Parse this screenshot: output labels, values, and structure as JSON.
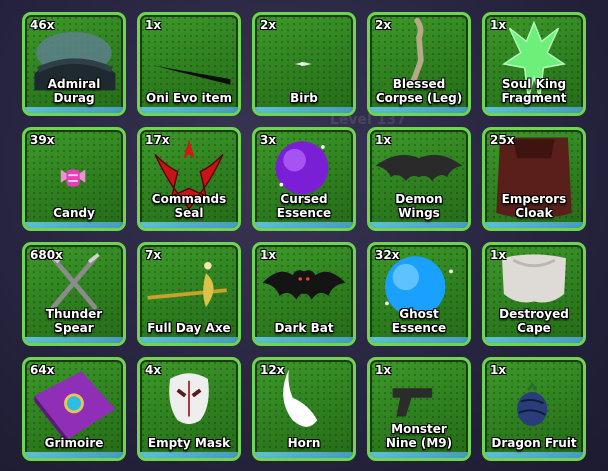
{
  "background_text": [
    "Level 137"
  ],
  "colors": {
    "slot_border": "#6fd44e",
    "slot_fill": "#2e7f1f",
    "slot_bottom": "#4aa3d0"
  },
  "items": [
    {
      "count": "46x",
      "name": "Admiral\nDurag",
      "icon": "durag-icon"
    },
    {
      "count": "1x",
      "name": "Oni Evo item",
      "icon": "oni-evo-item-icon"
    },
    {
      "count": "2x",
      "name": "Birb",
      "icon": "bird-icon"
    },
    {
      "count": "2x",
      "name": "Blessed\nCorpse (Leg)",
      "icon": "corpse-leg-icon"
    },
    {
      "count": "1x",
      "name": "Soul King\nFragment",
      "icon": "soul-king-fragment-icon"
    },
    {
      "count": "39x",
      "name": "Candy",
      "icon": "candy-icon"
    },
    {
      "count": "17x",
      "name": "Commands\nSeal",
      "icon": "commands-seal-icon"
    },
    {
      "count": "3x",
      "name": "Cursed\nEssence",
      "icon": "cursed-essence-orb-icon"
    },
    {
      "count": "1x",
      "name": "Demon\nWings",
      "icon": "demon-wings-icon"
    },
    {
      "count": "25x",
      "name": "Emperors\nCloak",
      "icon": "emperors-cloak-icon"
    },
    {
      "count": "680x",
      "name": "Thunder\nSpear",
      "icon": "thunder-spear-icon"
    },
    {
      "count": "7x",
      "name": "Full Day Axe",
      "icon": "axe-icon"
    },
    {
      "count": "1x",
      "name": "Dark Bat",
      "icon": "bat-icon"
    },
    {
      "count": "32x",
      "name": "Ghost\nEssence",
      "icon": "ghost-essence-orb-icon"
    },
    {
      "count": "1x",
      "name": "Destroyed\nCape",
      "icon": "destroyed-cape-icon"
    },
    {
      "count": "64x",
      "name": "Grimoire",
      "icon": "grimoire-book-icon"
    },
    {
      "count": "4x",
      "name": "Empty Mask",
      "icon": "mask-icon"
    },
    {
      "count": "12x",
      "name": "Horn",
      "icon": "horn-icon"
    },
    {
      "count": "1x",
      "name": "Monster\nNine (M9)",
      "icon": "pistol-icon"
    },
    {
      "count": "1x",
      "name": "Dragon Fruit",
      "icon": "dragon-fruit-icon"
    }
  ]
}
